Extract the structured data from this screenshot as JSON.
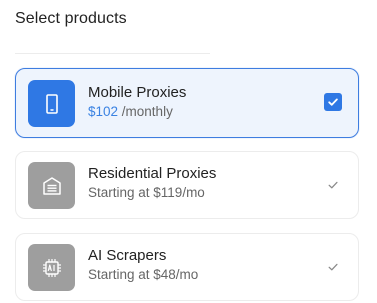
{
  "title": "Select products",
  "products": [
    {
      "name": "Mobile Proxies",
      "price": "$102",
      "period": " /monthly",
      "icon": "smartphone-icon",
      "selected": true
    },
    {
      "name": "Residential Proxies",
      "subtitle": "Starting at $119/mo",
      "icon": "garage-icon",
      "selected": false
    },
    {
      "name": "AI Scrapers",
      "subtitle": "Starting at $48/mo",
      "icon": "ai-chip-icon",
      "selected": false
    }
  ],
  "colors": {
    "accent": "#2f78e4",
    "price": "#3a82e2",
    "selected_bg": "#eef4fd",
    "icon_gray": "#9e9e9e"
  }
}
